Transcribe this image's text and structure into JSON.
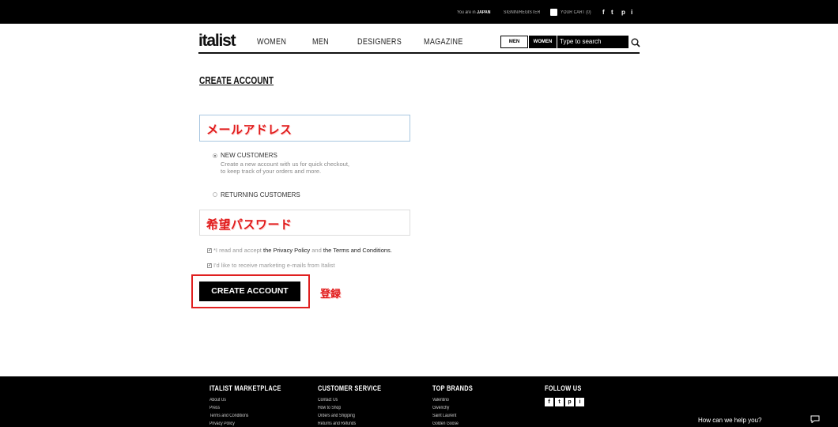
{
  "topbar": {
    "location_prefix": "You are in",
    "location": "JAPAN",
    "signin": "SIGNIN/REGISTER",
    "cart": "YOUR CART (0)",
    "social": [
      "f",
      "t",
      "p",
      "i"
    ]
  },
  "header": {
    "logo": "italist",
    "nav": [
      "WOMEN",
      "MEN",
      "DESIGNERS",
      "MAGAZINE"
    ],
    "gender_men": "MEN",
    "gender_women": "WOMEN",
    "search_placeholder": "Type to search"
  },
  "page": {
    "title": "CREATE ACCOUNT"
  },
  "form": {
    "email_annotation": "メールアドレス",
    "new_customers_label": "NEW CUSTOMERS",
    "new_customers_desc_1": "Create a new account with us for quick checkout,",
    "new_customers_desc_2": "to keep track of your orders and more.",
    "returning_label": "RETURNING CUSTOMERS",
    "password_annotation": "希望パスワード",
    "terms_prefix": "*I read and accept",
    "privacy_policy": "the Privacy Policy",
    "and": "and",
    "terms_conditions": "the Terms and Conditions.",
    "marketing_label": "I'd like to receive marketing e-mails from Italist",
    "create_button": "CREATE ACCOUNT",
    "register_annotation": "登録"
  },
  "footer": {
    "marketplace": {
      "title": "ITALIST MARKETPLACE",
      "links": [
        "About Us",
        "Press",
        "Terms and Conditions",
        "Privacy Policy"
      ]
    },
    "service": {
      "title": "CUSTOMER SERVICE",
      "links": [
        "Contact Us",
        "How to Shop",
        "Orders and Shipping",
        "Returns and Refunds"
      ]
    },
    "brands": {
      "title": "TOP BRANDS",
      "links": [
        "Valentino",
        "Givenchy",
        "Saint Laurent",
        "Golden Goose"
      ]
    },
    "follow": {
      "title": "FOLLOW US",
      "icons": [
        "f",
        "t",
        "p",
        "i"
      ]
    },
    "help": "How can we help you?"
  },
  "colors": {
    "annotation_red": "#e01b1b",
    "brand_black": "#000000",
    "email_border": "#a9c7e0"
  }
}
